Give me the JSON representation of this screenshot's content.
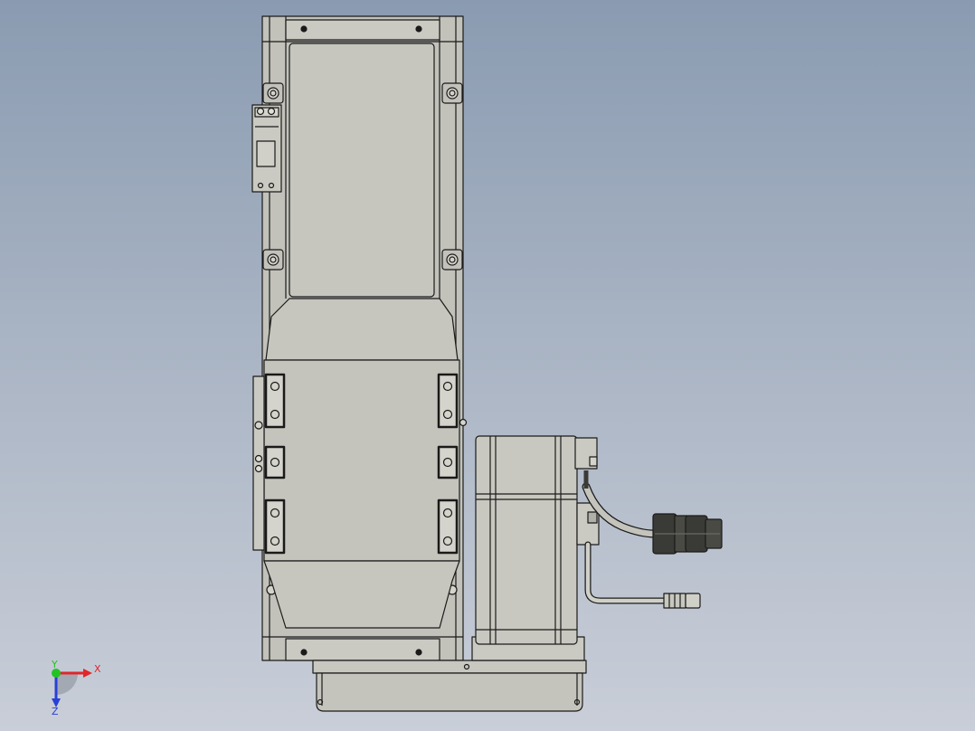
{
  "triad": {
    "x_label": "X",
    "y_label": "Y",
    "z_label": "Z",
    "x_color": "#e0262b",
    "y_color": "#22c322",
    "z_color": "#2a3fd6"
  },
  "colors": {
    "background_top": "#8a9bb1",
    "background_bottom": "#c9ced8",
    "part_fill": "#c4c4bc",
    "part_fill_light": "#d0d0c8",
    "edge": "#1a1a1a",
    "connector_dark": "#3a3a36"
  }
}
